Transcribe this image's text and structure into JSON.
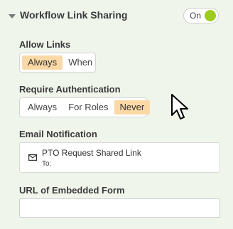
{
  "header": {
    "title": "Workflow Link Sharing",
    "toggle_label": "On",
    "toggle_on": true,
    "toggle_color": "#9ccc1f"
  },
  "allow_links": {
    "label": "Allow Links",
    "options": [
      "Always",
      "When"
    ],
    "selected": "Always"
  },
  "require_auth": {
    "label": "Require Authentication",
    "options": [
      "Always",
      "For Roles",
      "Never"
    ],
    "selected": "Never"
  },
  "email_notification": {
    "label": "Email Notification",
    "icon": "envelope-icon",
    "subject": "PTO Request Shared Link",
    "to_label": "To:"
  },
  "embedded_form": {
    "label": "URL of Embedded Form",
    "value": "",
    "placeholder": ""
  },
  "colors": {
    "background": "#f0f5ec",
    "selected_option": "#fbd9a6"
  }
}
